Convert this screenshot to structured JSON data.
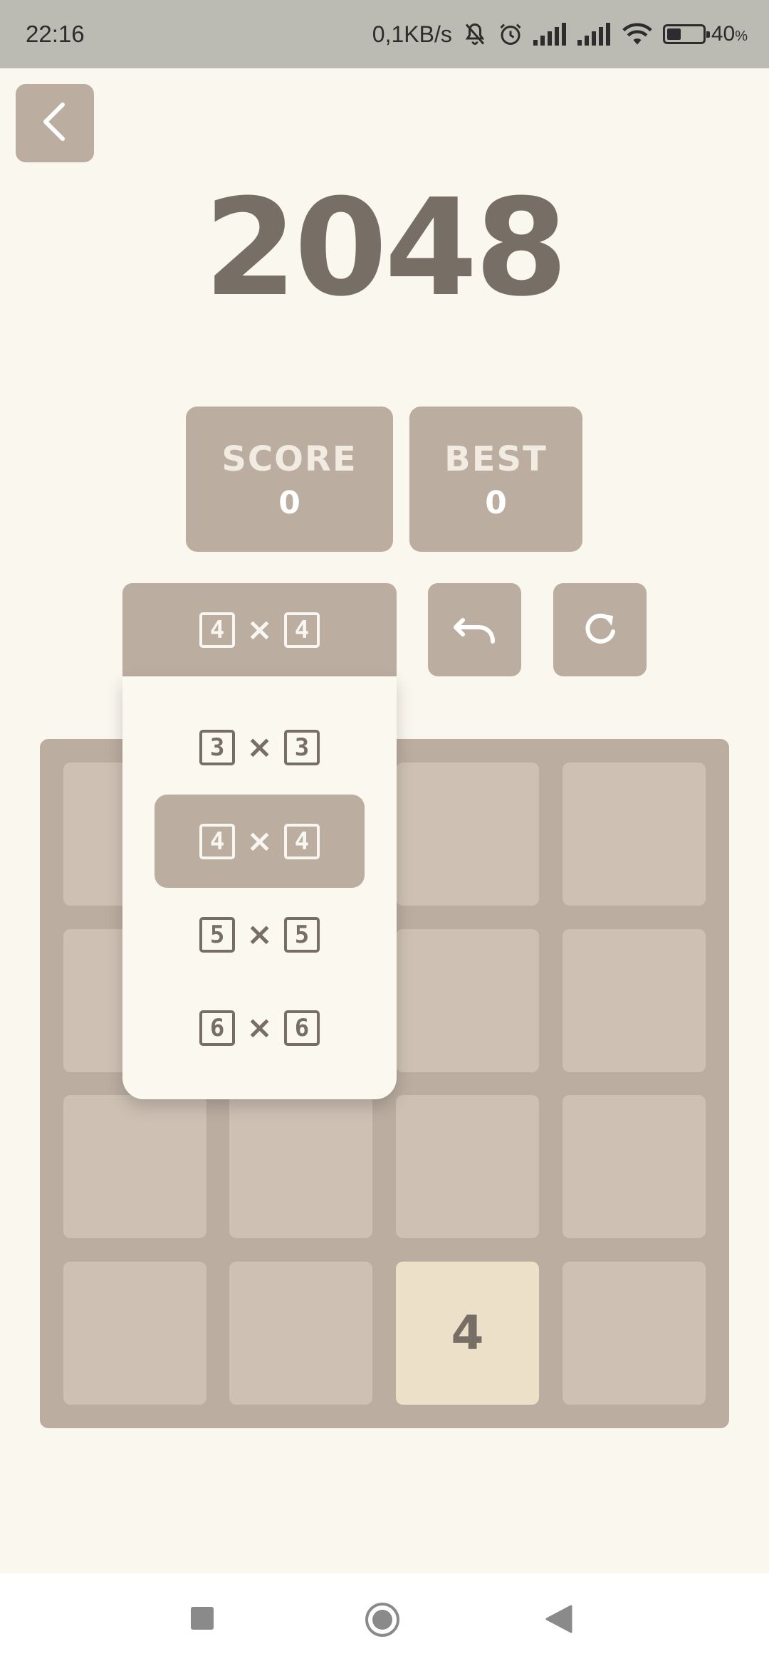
{
  "status_bar": {
    "time": "22:16",
    "network_speed": "0,1KB/s",
    "battery_percent": "40",
    "battery_unit": "%",
    "icons": [
      "mute-bell-icon",
      "alarm-icon",
      "signal-icon",
      "signal-icon",
      "wifi-icon",
      "battery-icon"
    ]
  },
  "header": {
    "back_icon": "chevron-left-icon",
    "title": "2048"
  },
  "scores": {
    "score_label": "SCORE",
    "score_value": "0",
    "best_label": "BEST",
    "best_value": "0"
  },
  "controls": {
    "size_rows": "4",
    "size_times": "×",
    "size_cols": "4",
    "undo_icon": "undo-icon",
    "restart_icon": "restart-icon"
  },
  "size_dropdown": {
    "options": [
      {
        "rows": "3",
        "times": "×",
        "cols": "3"
      },
      {
        "rows": "4",
        "times": "×",
        "cols": "4"
      },
      {
        "rows": "5",
        "times": "×",
        "cols": "5"
      },
      {
        "rows": "6",
        "times": "×",
        "cols": "6"
      }
    ],
    "selected_index": 1
  },
  "board": {
    "size": 4,
    "tiles": [
      [
        "",
        "",
        "",
        ""
      ],
      [
        "",
        "",
        "",
        ""
      ],
      [
        "",
        "",
        "",
        ""
      ],
      [
        "",
        "",
        "4",
        ""
      ]
    ]
  },
  "nav_bar": {
    "icons": [
      "recents-square-icon",
      "home-circle-icon",
      "back-triangle-icon"
    ]
  },
  "colors": {
    "background": "#faf7ee",
    "board": "#bbada0",
    "empty_cell": "#cec1b4",
    "tile_4": "#ede0c8",
    "text_dark": "#776e65"
  }
}
